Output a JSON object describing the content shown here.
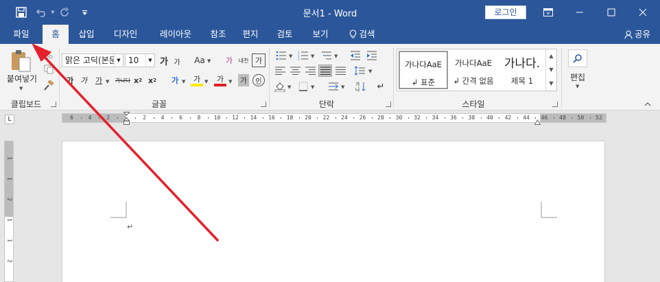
{
  "window": {
    "title": "문서1  -  Word",
    "login_label": "로그인"
  },
  "quick_access": {
    "save_icon": "save-icon",
    "undo_icon": "undo-icon",
    "redo_icon": "redo-icon",
    "customize_icon": "customize-quick-access-icon"
  },
  "tabs": [
    "파일",
    "홈",
    "삽입",
    "디자인",
    "레이아웃",
    "참조",
    "편지",
    "검토",
    "보기"
  ],
  "active_tab": "홈",
  "search_label": "검색",
  "share_label": "공유",
  "ribbon": {
    "clipboard": {
      "paste_label": "붙여넣기",
      "group_label": "클립보드"
    },
    "font": {
      "font_name": "맑은 고딕(본문",
      "font_size": "10",
      "group_label": "글꼴",
      "grow_font": "가",
      "case_label": "Aa",
      "clear_format": "가",
      "phonetic": "내천",
      "char_border": "가",
      "bold": "가",
      "italic": "가",
      "underline": "가",
      "strike": "가나다",
      "subscript": "x",
      "superscript": "x",
      "text_effect": "가",
      "highlight": "가",
      "font_color": "가",
      "char_shading": "가",
      "enclosed": "인"
    },
    "paragraph": {
      "group_label": "단락"
    },
    "styles": {
      "group_label": "스타일",
      "items": [
        {
          "preview": "가나다AaE",
          "name": "↲ 표준"
        },
        {
          "preview": "가나다AaE",
          "name": "↲ 간격 없음"
        },
        {
          "preview": "가나다.",
          "name": "제목 1"
        }
      ]
    },
    "editing": {
      "label": "편집"
    }
  },
  "ruler": {
    "tab_selector": "L",
    "left_numbers": [
      "6",
      "4",
      "2"
    ],
    "numbers": [
      "2",
      "4",
      "6",
      "8",
      "10",
      "12",
      "14",
      "16",
      "18",
      "20",
      "22",
      "24",
      "26",
      "28",
      "30",
      "32",
      "34",
      "36",
      "38",
      "40",
      "42",
      "44"
    ],
    "right_numbers": [
      "46",
      "48",
      "50",
      "52"
    ],
    "vertical_numbers": [
      "1",
      "1",
      "2",
      "1",
      "1",
      "2"
    ]
  },
  "document": {
    "paragraph_mark": "↵"
  },
  "colors": {
    "brand": "#2b579a",
    "ribbon_bg": "#f3f3f3",
    "arrow": "#e5202b"
  }
}
